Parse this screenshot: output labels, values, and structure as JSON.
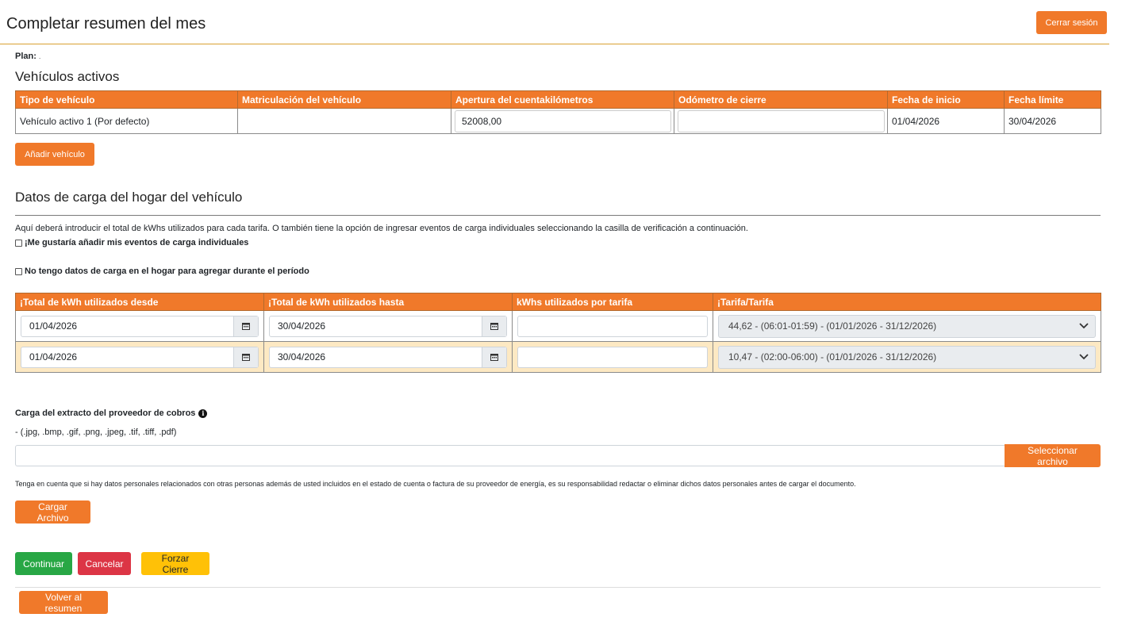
{
  "header": {
    "title": "Completar resumen del mes",
    "logout_label": "Cerrar sesión"
  },
  "plan": {
    "label": "Plan:",
    "value": "."
  },
  "vehicles": {
    "title": "Vehículos activos",
    "columns": [
      "Tipo de vehículo",
      "Matriculación del vehículo",
      "Apertura del cuentakilómetros",
      "Odómetro de cierre",
      "Fecha de inicio",
      "Fecha límite"
    ],
    "rows": [
      {
        "type": "Vehículo activo 1 (Por defecto)",
        "registration": "",
        "odometer_open": "52008,00",
        "odometer_close": "",
        "start_date": "01/04/2026",
        "end_date": "30/04/2026"
      }
    ],
    "add_label": "Añadir vehículo"
  },
  "charging": {
    "title": "Datos de carga del hogar del vehículo",
    "intro": "Aquí deberá introducir el total de kWhs utilizados para cada tarifa. O también tiene la opción de ingresar eventos de carga individuales seleccionando la casilla de verificación a continuación.",
    "checkbox_individual": "¡Me gustaría añadir mis eventos de carga individuales",
    "checkbox_no_data": "No tengo datos de carga en el hogar para agregar durante el período",
    "columns": [
      "¡Total de kWh utilizados desde",
      "¡Total de kWh utilizados hasta",
      "kWhs utilizados por tarifa",
      "¡Tarifa/Tarifa"
    ],
    "rows": [
      {
        "from": "01/04/2026",
        "to": "30/04/2026",
        "kwh": "",
        "tariff": "44,62 - (06:01-01:59) - (01/01/2026 - 31/12/2026)"
      },
      {
        "from": "01/04/2026",
        "to": "30/04/2026",
        "kwh": "",
        "tariff": "10,47 - (02:00-06:00) - (01/01/2026 - 31/12/2026)"
      }
    ]
  },
  "upload": {
    "title": "Carga del extracto del proveedor de cobros",
    "file_types": "- (.jpg, .bmp, .gif, .png, .jpeg, .tif, .tiff, .pdf)",
    "file_value": "",
    "select_label": "Seleccionar archivo",
    "note": "Tenga en cuenta que si hay datos personales relacionados con otras personas además de usted incluidos en el estado de cuenta o factura de su proveedor de energía, es su responsabilidad redactar o eliminar dichos datos personales antes de cargar el documento.",
    "upload_label": "Cargar Archivo"
  },
  "actions": {
    "continue_label": "Continuar",
    "cancel_label": "Cancelar",
    "force_close_label": "Forzar Cierre",
    "back_label": "Volver al resumen"
  },
  "colors": {
    "accent": "#f0792a",
    "row_highlight": "#fde9c3",
    "success": "#28a745",
    "danger": "#dc3545",
    "warning": "#ffc107"
  },
  "icons": [
    "calendar-icon",
    "chevron-down-icon",
    "info-icon"
  ]
}
